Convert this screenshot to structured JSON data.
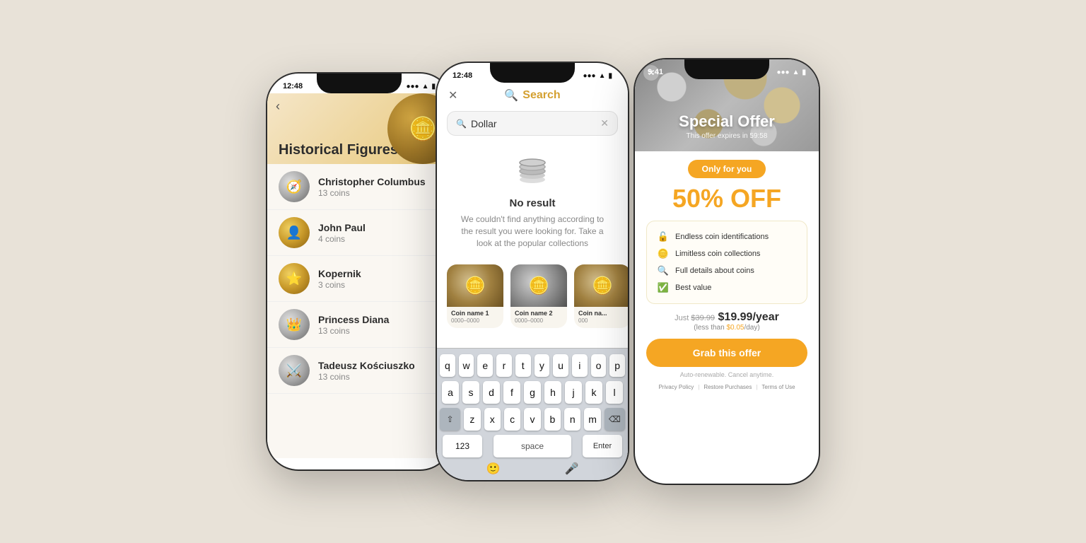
{
  "phone1": {
    "status_time": "12:48",
    "title": "Historical Figures",
    "back_label": "‹",
    "figures": [
      {
        "name": "Christopher Columbus",
        "coins": "13 coins",
        "avatar_type": "silver",
        "emoji": "🧭"
      },
      {
        "name": "John Paul",
        "coins": "4 coins",
        "avatar_type": "gold",
        "emoji": "👤"
      },
      {
        "name": "Kopernik",
        "coins": "3 coins",
        "avatar_type": "gold",
        "emoji": "⭐"
      },
      {
        "name": "Princess Diana",
        "coins": "13 coins",
        "avatar_type": "silver",
        "emoji": "👑"
      },
      {
        "name": "Tadeusz Kościuszko",
        "coins": "13 coins",
        "avatar_type": "silver",
        "emoji": "⚔️"
      }
    ]
  },
  "phone2": {
    "status_time": "12:48",
    "title": "Search",
    "search_query": "Dollar",
    "search_placeholder": "Dollar",
    "no_result_title": "No result",
    "no_result_desc": "We couldn't find anything according to the result you were looking for. Take a look at the popular collections",
    "collections": [
      {
        "name": "Coin name 1",
        "year": "0000–0000",
        "type": "gold"
      },
      {
        "name": "Coin name 2",
        "year": "0000–0000",
        "type": "silver"
      },
      {
        "name": "Coin na...",
        "year": "000",
        "type": "gold"
      }
    ],
    "keyboard_rows": [
      [
        "q",
        "w",
        "e",
        "r",
        "t",
        "y",
        "u",
        "i",
        "o",
        "p"
      ],
      [
        "a",
        "s",
        "d",
        "f",
        "g",
        "h",
        "j",
        "k",
        "l"
      ],
      [
        "z",
        "x",
        "c",
        "v",
        "b",
        "n",
        "m"
      ]
    ],
    "special_keys": {
      "shift": "⇧",
      "delete": "⌫",
      "numbers": "123",
      "space": "space",
      "enter": "Enter",
      "emoji": "🙂",
      "mic": "🎤"
    }
  },
  "phone3": {
    "status_time": "9:41",
    "offer_title": "Special Offer",
    "expires_text": "This offer expires in 59:58",
    "only_for_you": "Only for you",
    "discount": "50% OFF",
    "features": [
      {
        "icon": "🔓",
        "text": "Endless coin identifications"
      },
      {
        "icon": "🪙",
        "text": "Limitless coin collections"
      },
      {
        "icon": "🔍",
        "text": "Full details about coins"
      },
      {
        "icon": "✅",
        "text": "Best value"
      }
    ],
    "old_price": "$39.99",
    "new_price": "$19.99/year",
    "just_label": "Just",
    "per_day_text": "(less than $0.05/day)",
    "grab_btn": "Grab this offer",
    "auto_renew": "Auto-renewable. Cancel anytime.",
    "footer_links": [
      "Privacy Policy",
      "Restore Purchases",
      "Terms of Use"
    ],
    "close_icon": "✕"
  }
}
